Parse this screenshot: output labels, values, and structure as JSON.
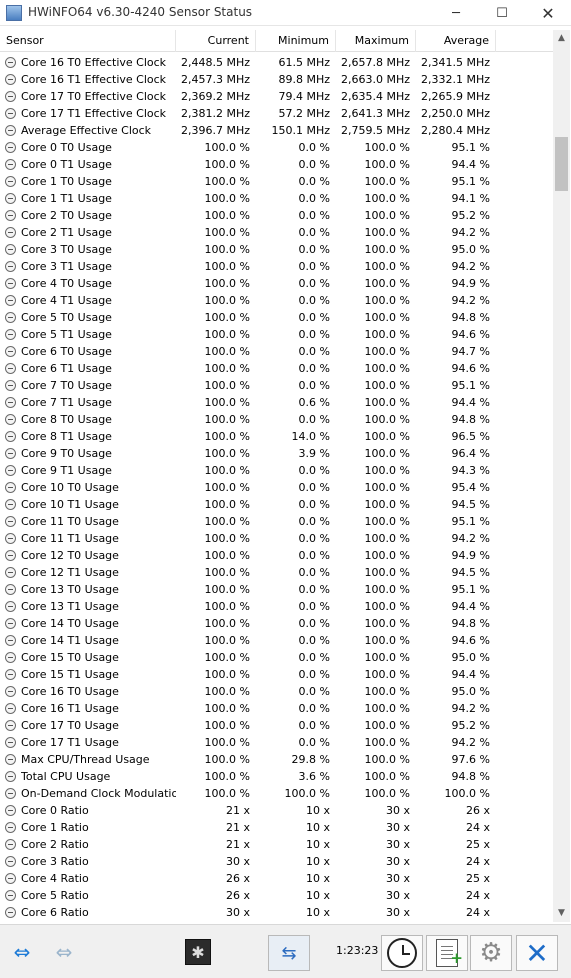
{
  "window": {
    "title": "HWiNFO64 v6.30-4240 Sensor Status",
    "minimize_glyph": "─",
    "maximize_glyph": "☐",
    "close_glyph": "✕"
  },
  "table": {
    "columns": [
      "Sensor",
      "Current",
      "Minimum",
      "Maximum",
      "Average"
    ],
    "rows": [
      {
        "name": "Core 16 T0 Effective Clock",
        "current": "2,448.5 MHz",
        "minimum": "61.5 MHz",
        "maximum": "2,657.8 MHz",
        "average": "2,341.5 MHz"
      },
      {
        "name": "Core 16 T1 Effective Clock",
        "current": "2,457.3 MHz",
        "minimum": "89.8 MHz",
        "maximum": "2,663.0 MHz",
        "average": "2,332.1 MHz"
      },
      {
        "name": "Core 17 T0 Effective Clock",
        "current": "2,369.2 MHz",
        "minimum": "79.4 MHz",
        "maximum": "2,635.4 MHz",
        "average": "2,265.9 MHz"
      },
      {
        "name": "Core 17 T1 Effective Clock",
        "current": "2,381.2 MHz",
        "minimum": "57.2 MHz",
        "maximum": "2,641.3 MHz",
        "average": "2,250.0 MHz"
      },
      {
        "name": "Average Effective Clock",
        "current": "2,396.7 MHz",
        "minimum": "150.1 MHz",
        "maximum": "2,759.5 MHz",
        "average": "2,280.4 MHz"
      },
      {
        "name": "Core 0 T0 Usage",
        "current": "100.0 %",
        "minimum": "0.0 %",
        "maximum": "100.0 %",
        "average": "95.1 %"
      },
      {
        "name": "Core 0 T1 Usage",
        "current": "100.0 %",
        "minimum": "0.0 %",
        "maximum": "100.0 %",
        "average": "94.4 %"
      },
      {
        "name": "Core 1 T0 Usage",
        "current": "100.0 %",
        "minimum": "0.0 %",
        "maximum": "100.0 %",
        "average": "95.1 %"
      },
      {
        "name": "Core 1 T1 Usage",
        "current": "100.0 %",
        "minimum": "0.0 %",
        "maximum": "100.0 %",
        "average": "94.1 %"
      },
      {
        "name": "Core 2 T0 Usage",
        "current": "100.0 %",
        "minimum": "0.0 %",
        "maximum": "100.0 %",
        "average": "95.2 %"
      },
      {
        "name": "Core 2 T1 Usage",
        "current": "100.0 %",
        "minimum": "0.0 %",
        "maximum": "100.0 %",
        "average": "94.2 %"
      },
      {
        "name": "Core 3 T0 Usage",
        "current": "100.0 %",
        "minimum": "0.0 %",
        "maximum": "100.0 %",
        "average": "95.0 %"
      },
      {
        "name": "Core 3 T1 Usage",
        "current": "100.0 %",
        "minimum": "0.0 %",
        "maximum": "100.0 %",
        "average": "94.2 %"
      },
      {
        "name": "Core 4 T0 Usage",
        "current": "100.0 %",
        "minimum": "0.0 %",
        "maximum": "100.0 %",
        "average": "94.9 %"
      },
      {
        "name": "Core 4 T1 Usage",
        "current": "100.0 %",
        "minimum": "0.0 %",
        "maximum": "100.0 %",
        "average": "94.2 %"
      },
      {
        "name": "Core 5 T0 Usage",
        "current": "100.0 %",
        "minimum": "0.0 %",
        "maximum": "100.0 %",
        "average": "94.8 %"
      },
      {
        "name": "Core 5 T1 Usage",
        "current": "100.0 %",
        "minimum": "0.0 %",
        "maximum": "100.0 %",
        "average": "94.6 %"
      },
      {
        "name": "Core 6 T0 Usage",
        "current": "100.0 %",
        "minimum": "0.0 %",
        "maximum": "100.0 %",
        "average": "94.7 %"
      },
      {
        "name": "Core 6 T1 Usage",
        "current": "100.0 %",
        "minimum": "0.0 %",
        "maximum": "100.0 %",
        "average": "94.6 %"
      },
      {
        "name": "Core 7 T0 Usage",
        "current": "100.0 %",
        "minimum": "0.0 %",
        "maximum": "100.0 %",
        "average": "95.1 %"
      },
      {
        "name": "Core 7 T1 Usage",
        "current": "100.0 %",
        "minimum": "0.6 %",
        "maximum": "100.0 %",
        "average": "94.4 %"
      },
      {
        "name": "Core 8 T0 Usage",
        "current": "100.0 %",
        "minimum": "0.0 %",
        "maximum": "100.0 %",
        "average": "94.8 %"
      },
      {
        "name": "Core 8 T1 Usage",
        "current": "100.0 %",
        "minimum": "14.0 %",
        "maximum": "100.0 %",
        "average": "96.5 %"
      },
      {
        "name": "Core 9 T0 Usage",
        "current": "100.0 %",
        "minimum": "3.9 %",
        "maximum": "100.0 %",
        "average": "96.4 %"
      },
      {
        "name": "Core 9 T1 Usage",
        "current": "100.0 %",
        "minimum": "0.0 %",
        "maximum": "100.0 %",
        "average": "94.3 %"
      },
      {
        "name": "Core 10 T0 Usage",
        "current": "100.0 %",
        "minimum": "0.0 %",
        "maximum": "100.0 %",
        "average": "95.4 %"
      },
      {
        "name": "Core 10 T1 Usage",
        "current": "100.0 %",
        "minimum": "0.0 %",
        "maximum": "100.0 %",
        "average": "94.5 %"
      },
      {
        "name": "Core 11 T0 Usage",
        "current": "100.0 %",
        "minimum": "0.0 %",
        "maximum": "100.0 %",
        "average": "95.1 %"
      },
      {
        "name": "Core 11 T1 Usage",
        "current": "100.0 %",
        "minimum": "0.0 %",
        "maximum": "100.0 %",
        "average": "94.2 %"
      },
      {
        "name": "Core 12 T0 Usage",
        "current": "100.0 %",
        "minimum": "0.0 %",
        "maximum": "100.0 %",
        "average": "94.9 %"
      },
      {
        "name": "Core 12 T1 Usage",
        "current": "100.0 %",
        "minimum": "0.0 %",
        "maximum": "100.0 %",
        "average": "94.5 %"
      },
      {
        "name": "Core 13 T0 Usage",
        "current": "100.0 %",
        "minimum": "0.0 %",
        "maximum": "100.0 %",
        "average": "95.1 %"
      },
      {
        "name": "Core 13 T1 Usage",
        "current": "100.0 %",
        "minimum": "0.0 %",
        "maximum": "100.0 %",
        "average": "94.4 %"
      },
      {
        "name": "Core 14 T0 Usage",
        "current": "100.0 %",
        "minimum": "0.0 %",
        "maximum": "100.0 %",
        "average": "94.8 %"
      },
      {
        "name": "Core 14 T1 Usage",
        "current": "100.0 %",
        "minimum": "0.0 %",
        "maximum": "100.0 %",
        "average": "94.6 %"
      },
      {
        "name": "Core 15 T0 Usage",
        "current": "100.0 %",
        "minimum": "0.0 %",
        "maximum": "100.0 %",
        "average": "95.0 %"
      },
      {
        "name": "Core 15 T1 Usage",
        "current": "100.0 %",
        "minimum": "0.0 %",
        "maximum": "100.0 %",
        "average": "94.4 %"
      },
      {
        "name": "Core 16 T0 Usage",
        "current": "100.0 %",
        "minimum": "0.0 %",
        "maximum": "100.0 %",
        "average": "95.0 %"
      },
      {
        "name": "Core 16 T1 Usage",
        "current": "100.0 %",
        "minimum": "0.0 %",
        "maximum": "100.0 %",
        "average": "94.2 %"
      },
      {
        "name": "Core 17 T0 Usage",
        "current": "100.0 %",
        "minimum": "0.0 %",
        "maximum": "100.0 %",
        "average": "95.2 %"
      },
      {
        "name": "Core 17 T1 Usage",
        "current": "100.0 %",
        "minimum": "0.0 %",
        "maximum": "100.0 %",
        "average": "94.2 %"
      },
      {
        "name": "Max CPU/Thread Usage",
        "current": "100.0 %",
        "minimum": "29.8 %",
        "maximum": "100.0 %",
        "average": "97.6 %"
      },
      {
        "name": "Total CPU Usage",
        "current": "100.0 %",
        "minimum": "3.6 %",
        "maximum": "100.0 %",
        "average": "94.8 %"
      },
      {
        "name": "On-Demand Clock Modulation",
        "current": "100.0 %",
        "minimum": "100.0 %",
        "maximum": "100.0 %",
        "average": "100.0 %"
      },
      {
        "name": "Core 0 Ratio",
        "current": "21 x",
        "minimum": "10 x",
        "maximum": "30 x",
        "average": "26 x"
      },
      {
        "name": "Core 1 Ratio",
        "current": "21 x",
        "minimum": "10 x",
        "maximum": "30 x",
        "average": "24 x"
      },
      {
        "name": "Core 2 Ratio",
        "current": "21 x",
        "minimum": "10 x",
        "maximum": "30 x",
        "average": "25 x"
      },
      {
        "name": "Core 3 Ratio",
        "current": "30 x",
        "minimum": "10 x",
        "maximum": "30 x",
        "average": "24 x"
      },
      {
        "name": "Core 4 Ratio",
        "current": "26 x",
        "minimum": "10 x",
        "maximum": "30 x",
        "average": "25 x"
      },
      {
        "name": "Core 5 Ratio",
        "current": "26 x",
        "minimum": "10 x",
        "maximum": "30 x",
        "average": "24 x"
      },
      {
        "name": "Core 6 Ratio",
        "current": "30 x",
        "minimum": "10 x",
        "maximum": "30 x",
        "average": "24 x"
      }
    ]
  },
  "scrollbar": {
    "up_glyph": "▲",
    "down_glyph": "▼"
  },
  "toolbar": {
    "nav_left_glyph": "⇔",
    "nav_right_glyph": "⇔",
    "fan_glyph": "✱",
    "network_glyph": "⇆",
    "elapsed_time": "1:23:23",
    "report_plus_glyph": "+",
    "settings_glyph": "⚙",
    "close_glyph": "✕"
  },
  "colors": {
    "accent_blue": "#1e7bd6",
    "background": "#ffffff",
    "toolbar_background": "#f0f0f0"
  }
}
